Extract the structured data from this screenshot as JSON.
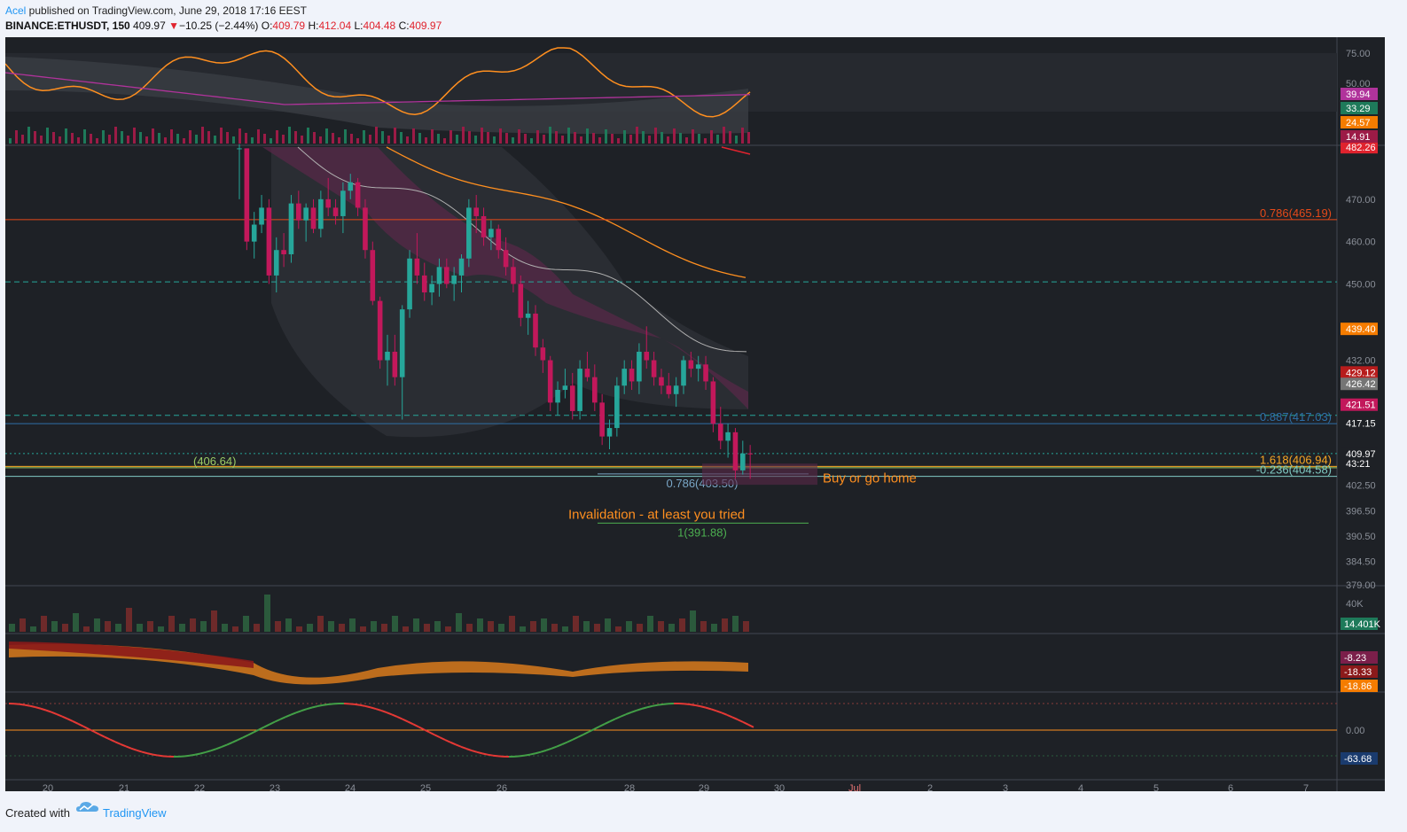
{
  "header": {
    "author": "Acel",
    "published": " published on TradingView.com, June 29, 2018 17:16 EEST",
    "symbol": "BINANCE:ETHUSDT, 150",
    "last": "409.97",
    "change": "−10.25 (−2.44%)",
    "o_label": "O:",
    "o_val": "409.79",
    "h_label": "H:",
    "h_val": "412.04",
    "l_label": "L:",
    "l_val": "404.48",
    "c_label": "C:",
    "c_val": "409.97"
  },
  "footer": {
    "created_with": "Created with",
    "brand": "TradingView"
  },
  "colors": {
    "background": "#1e2126",
    "up": "#26a69a",
    "down": "#c2185b",
    "orange": "#ff8f1f",
    "accent_blue": "#2196f3"
  },
  "chart_data": {
    "type": "candlestick",
    "price_axis": {
      "ticks": [
        "470.00",
        "460.00",
        "450.00",
        "432.00",
        "402.50",
        "396.50",
        "390.50",
        "384.50",
        "379.00"
      ],
      "range": [
        379.0,
        482.3
      ],
      "badges": [
        {
          "value": 482.26,
          "label": "482.26",
          "color": "#e0232e"
        },
        {
          "value": 439.4,
          "label": "439.40",
          "color": "#f57c00"
        },
        {
          "value": 429.12,
          "label": "429.12",
          "color": "#b71c1c"
        },
        {
          "value": 426.42,
          "label": "426.42",
          "color": "#757575"
        },
        {
          "value": 421.51,
          "label": "421.51",
          "color": "#c2185b"
        },
        {
          "value": 417.15,
          "label": "417.15",
          "color": "#1e2126"
        },
        {
          "value": 409.97,
          "label": "409.97",
          "color": "#1e2126"
        },
        {
          "value": 407.6,
          "label": "43:21",
          "color": "#1e2126"
        }
      ]
    },
    "time_axis": [
      "20",
      "21",
      "22",
      "23",
      "24",
      "25",
      "26",
      "28",
      "29",
      "30",
      "Jul",
      "2",
      "3",
      "4",
      "5",
      "6",
      "7"
    ],
    "levels": [
      {
        "value": 465.19,
        "label": "0.786(465.19)",
        "color": "#e64a19",
        "style": "solid"
      },
      {
        "value": 450.5,
        "label": "",
        "color": "#26a69a",
        "style": "dashed"
      },
      {
        "value": 419.0,
        "label": "",
        "color": "#26a69a",
        "style": "dashed"
      },
      {
        "value": 417.03,
        "label": "0.887(417.03)",
        "color": "#2e6fa8",
        "style": "solid"
      },
      {
        "value": 409.97,
        "label": "",
        "color": "#26a69a",
        "style": "dotted"
      },
      {
        "value": 406.94,
        "label": "1.618(406.94)",
        "color": "#f9a825",
        "style": "solid"
      },
      {
        "value": 406.64,
        "label": "(406.64)",
        "color": "#9ccc65",
        "style": "solid"
      },
      {
        "value": 404.58,
        "label": "-0.236(404.58)",
        "color": "#80cbc4",
        "style": "solid"
      }
    ],
    "fib_labels": [
      {
        "value": 403.5,
        "label": "0.786(403.50)",
        "color": "#7aa7c7"
      },
      {
        "value": 391.88,
        "label": "1(391.88)",
        "color": "#4caf50"
      }
    ],
    "annotations": [
      "Buy or go home",
      "Invalidation - at least you tried"
    ],
    "candles": [
      {
        "o": 482,
        "h": 483,
        "l": 470,
        "c": 482
      },
      {
        "o": 482,
        "h": 482,
        "l": 458,
        "c": 460
      },
      {
        "o": 460,
        "h": 467,
        "l": 456,
        "c": 464
      },
      {
        "o": 464,
        "h": 471,
        "l": 462,
        "c": 468
      },
      {
        "o": 468,
        "h": 470,
        "l": 450,
        "c": 452
      },
      {
        "o": 452,
        "h": 461,
        "l": 448,
        "c": 458
      },
      {
        "o": 458,
        "h": 462,
        "l": 454,
        "c": 457
      },
      {
        "o": 457,
        "h": 471,
        "l": 455,
        "c": 469
      },
      {
        "o": 469,
        "h": 472,
        "l": 463,
        "c": 465
      },
      {
        "o": 465,
        "h": 469,
        "l": 460,
        "c": 468
      },
      {
        "o": 468,
        "h": 470,
        "l": 462,
        "c": 463
      },
      {
        "o": 463,
        "h": 472,
        "l": 461,
        "c": 470
      },
      {
        "o": 470,
        "h": 475,
        "l": 466,
        "c": 468
      },
      {
        "o": 468,
        "h": 470,
        "l": 464,
        "c": 466
      },
      {
        "o": 466,
        "h": 474,
        "l": 462,
        "c": 472
      },
      {
        "o": 472,
        "h": 476,
        "l": 470,
        "c": 474
      },
      {
        "o": 474,
        "h": 475,
        "l": 466,
        "c": 468
      },
      {
        "o": 468,
        "h": 470,
        "l": 456,
        "c": 458
      },
      {
        "o": 458,
        "h": 460,
        "l": 445,
        "c": 446
      },
      {
        "o": 446,
        "h": 447,
        "l": 430,
        "c": 432
      },
      {
        "o": 432,
        "h": 438,
        "l": 426,
        "c": 434
      },
      {
        "o": 434,
        "h": 438,
        "l": 426,
        "c": 428
      },
      {
        "o": 428,
        "h": 445,
        "l": 418,
        "c": 444
      },
      {
        "o": 444,
        "h": 458,
        "l": 442,
        "c": 456
      },
      {
        "o": 456,
        "h": 462,
        "l": 450,
        "c": 452
      },
      {
        "o": 452,
        "h": 455,
        "l": 446,
        "c": 448
      },
      {
        "o": 448,
        "h": 452,
        "l": 445,
        "c": 450
      },
      {
        "o": 450,
        "h": 456,
        "l": 447,
        "c": 454
      },
      {
        "o": 454,
        "h": 456,
        "l": 449,
        "c": 450
      },
      {
        "o": 450,
        "h": 454,
        "l": 446,
        "c": 452
      },
      {
        "o": 452,
        "h": 457,
        "l": 448,
        "c": 456
      },
      {
        "o": 456,
        "h": 470,
        "l": 454,
        "c": 468
      },
      {
        "o": 468,
        "h": 471,
        "l": 462,
        "c": 466
      },
      {
        "o": 466,
        "h": 468,
        "l": 459,
        "c": 461
      },
      {
        "o": 461,
        "h": 465,
        "l": 458,
        "c": 463
      },
      {
        "o": 463,
        "h": 464,
        "l": 456,
        "c": 458
      },
      {
        "o": 458,
        "h": 461,
        "l": 452,
        "c": 454
      },
      {
        "o": 454,
        "h": 456,
        "l": 448,
        "c": 450
      },
      {
        "o": 450,
        "h": 452,
        "l": 440,
        "c": 442
      },
      {
        "o": 442,
        "h": 446,
        "l": 438,
        "c": 443
      },
      {
        "o": 443,
        "h": 445,
        "l": 433,
        "c": 435
      },
      {
        "o": 435,
        "h": 437,
        "l": 429,
        "c": 432
      },
      {
        "o": 432,
        "h": 433,
        "l": 420,
        "c": 422
      },
      {
        "o": 422,
        "h": 427,
        "l": 419,
        "c": 425
      },
      {
        "o": 425,
        "h": 430,
        "l": 423,
        "c": 426
      },
      {
        "o": 426,
        "h": 429,
        "l": 418,
        "c": 420
      },
      {
        "o": 420,
        "h": 432,
        "l": 418,
        "c": 430
      },
      {
        "o": 430,
        "h": 434,
        "l": 427,
        "c": 428
      },
      {
        "o": 428,
        "h": 431,
        "l": 420,
        "c": 422
      },
      {
        "o": 422,
        "h": 424,
        "l": 412,
        "c": 414
      },
      {
        "o": 414,
        "h": 418,
        "l": 411,
        "c": 416
      },
      {
        "o": 416,
        "h": 428,
        "l": 414,
        "c": 426
      },
      {
        "o": 426,
        "h": 432,
        "l": 424,
        "c": 430
      },
      {
        "o": 430,
        "h": 432,
        "l": 425,
        "c": 427
      },
      {
        "o": 427,
        "h": 436,
        "l": 424,
        "c": 434
      },
      {
        "o": 434,
        "h": 440,
        "l": 430,
        "c": 432
      },
      {
        "o": 432,
        "h": 434,
        "l": 426,
        "c": 428
      },
      {
        "o": 428,
        "h": 430,
        "l": 424,
        "c": 426
      },
      {
        "o": 426,
        "h": 429,
        "l": 423,
        "c": 424
      },
      {
        "o": 424,
        "h": 428,
        "l": 421,
        "c": 426
      },
      {
        "o": 426,
        "h": 433,
        "l": 424,
        "c": 432
      },
      {
        "o": 432,
        "h": 434,
        "l": 428,
        "c": 430
      },
      {
        "o": 430,
        "h": 433,
        "l": 427,
        "c": 431
      },
      {
        "o": 431,
        "h": 433,
        "l": 425,
        "c": 427
      },
      {
        "o": 427,
        "h": 428,
        "l": 415,
        "c": 417
      },
      {
        "o": 417,
        "h": 421,
        "l": 411,
        "c": 413
      },
      {
        "o": 413,
        "h": 417,
        "l": 409,
        "c": 415
      },
      {
        "o": 415,
        "h": 416,
        "l": 404,
        "c": 406
      },
      {
        "o": 406,
        "h": 413,
        "l": 405,
        "c": 410
      },
      {
        "o": 410,
        "h": 412,
        "l": 404,
        "c": 409.97
      }
    ],
    "volume": {
      "badge": "14.401K",
      "tick": "40K",
      "values": [
        3,
        5,
        2,
        6,
        4,
        3,
        7,
        2,
        5,
        4,
        3,
        9,
        3,
        4,
        2,
        6,
        3,
        5,
        4,
        8,
        3,
        2,
        6,
        3,
        14,
        4,
        5,
        2,
        3,
        6,
        4,
        3,
        5,
        2,
        4,
        3,
        6,
        2,
        5,
        3,
        4,
        2,
        7,
        3,
        5,
        4,
        3,
        6,
        2,
        4,
        5,
        3,
        2,
        6,
        4,
        3,
        5,
        2,
        4,
        3,
        6,
        4,
        3,
        5,
        8,
        4,
        3,
        5,
        6,
        4
      ]
    },
    "rsi": {
      "ticks": [
        "75.00",
        "50.00"
      ],
      "badges": [
        "39.94",
        "33.29",
        "24.57",
        "14.91"
      ]
    },
    "osc_mid": {
      "badges": [
        "-8.23",
        "-18.33",
        "-18.86"
      ]
    },
    "osc_bottom": {
      "tick": "0.00",
      "badge": "-63.68"
    }
  }
}
